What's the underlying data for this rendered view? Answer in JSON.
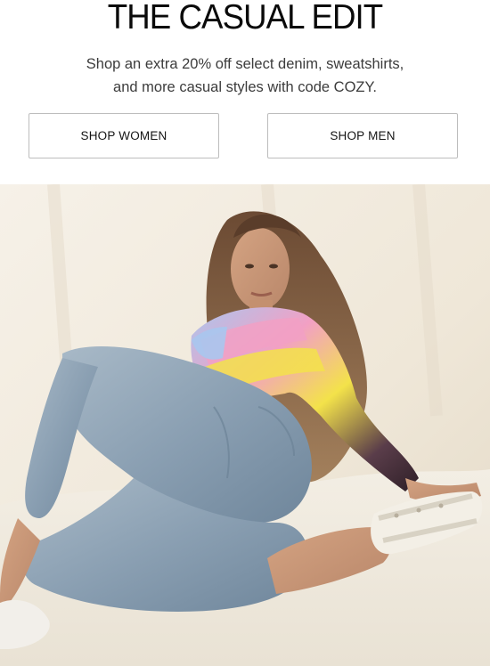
{
  "header": {
    "title": "THE CASUAL EDIT",
    "subtitle_line1": "Shop an extra 20% off select denim, sweatshirts,",
    "subtitle_line2": "and more casual styles with code COZY."
  },
  "buttons": {
    "women_label": "SHOP WOMEN",
    "men_label": "SHOP MEN"
  },
  "hero": {
    "image_name": "hero-photo-model-in-tie-dye-sweatshirt-and-jeans"
  },
  "colors": {
    "text": "#0a0a0a",
    "subtext": "#3c3c3c",
    "button_border": "#bdbdbd",
    "backdrop": "#f1ebdf",
    "denim": "#8fa3b5",
    "tie_dye_pink": "#f2a0c4",
    "tie_dye_yellow": "#f3e24a",
    "tie_dye_blue": "#a9c6ee",
    "tie_dye_dark": "#3a2630"
  }
}
